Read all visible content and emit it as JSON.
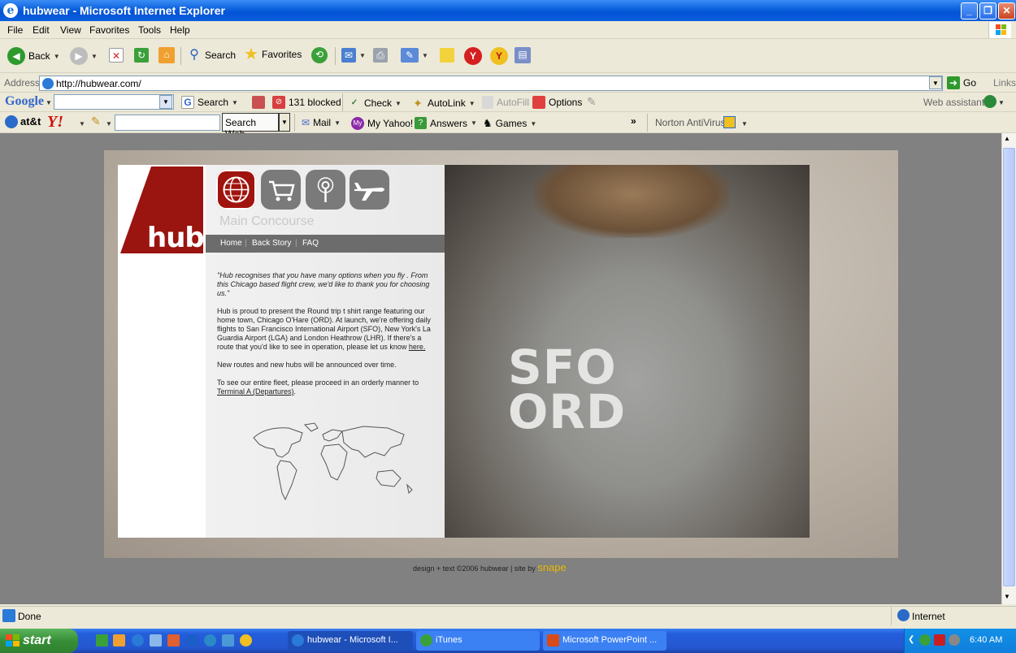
{
  "window": {
    "title": "hubwear - Microsoft Internet Explorer"
  },
  "menu": [
    "File",
    "Edit",
    "View",
    "Favorites",
    "Tools",
    "Help"
  ],
  "toolbar": {
    "back": "Back",
    "search": "Search",
    "favorites": "Favorites"
  },
  "address": {
    "label": "Address",
    "url": "http://hubwear.com/",
    "go": "Go",
    "links": "Links"
  },
  "google_bar": {
    "brand": "Google",
    "search": "Search",
    "blocked": "131 blocked",
    "check": "Check",
    "autolink": "AutoLink",
    "autofill": "AutoFill",
    "options": "Options",
    "web_assistant": "Web assistant"
  },
  "yahoo_bar": {
    "att": "at&t",
    "yahoo": "Y!",
    "search_web": "Search Web",
    "mail": "Mail",
    "my_yahoo": "My Yahoo!",
    "answers": "Answers",
    "games": "Games",
    "more": "»",
    "norton": "Norton AntiVirus"
  },
  "site": {
    "logo_text": "hub",
    "section_title": "Main Concourse",
    "nav": [
      "Home",
      "Back Story",
      "FAQ"
    ],
    "nav_sep": "|",
    "quote": "\"Hub recognises that you have many options when you fly . From this Chicago based flight crew, we'd like to thank you for choosing us.\"",
    "para1": "Hub is proud to present the Round trip t shirt range featuring our home town, Chicago O'Hare (ORD). At launch, we're offering daily flights to San Francisco International Airport (SFO), New York's La Guardia Airport (LGA) and London Heathrow (LHR). If there's a route that you'd like to see in operation, please let us know ",
    "para1_link": "here.",
    "para2": "New routes and new hubs will be announced over time.",
    "para3": "To see our entire fleet, please proceed in an orderly manner to ",
    "para3_link": "Terminal A (Departures)",
    "para3_end": ".",
    "shirt_line1": "SFO",
    "shirt_line2": "ORD",
    "footer": "design + text ©2006 hubwear | site by ",
    "footer_brand": "snape"
  },
  "status": {
    "text": "Done",
    "zone": "Internet"
  },
  "taskbar": {
    "start": "start",
    "tasks": [
      "hubwear - Microsoft I...",
      "iTunes",
      "Microsoft PowerPoint ..."
    ],
    "time": "6:40 AM"
  }
}
